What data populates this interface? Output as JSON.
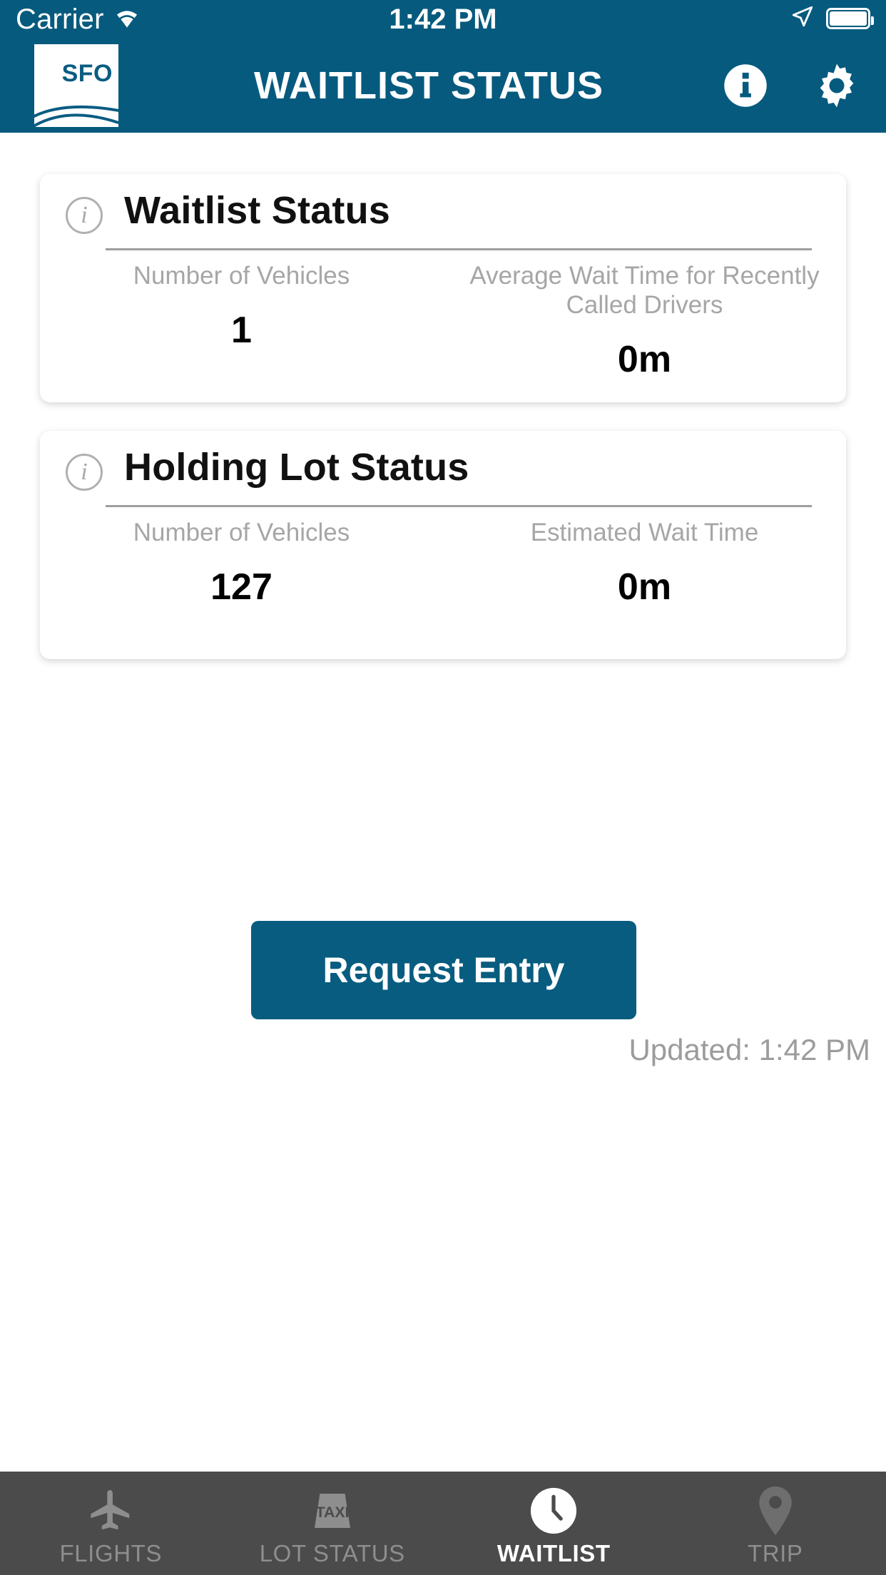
{
  "status_bar": {
    "carrier": "Carrier",
    "time": "1:42 PM",
    "wifi_icon": "wifi-icon",
    "location_icon": "location-arrow-icon",
    "battery_icon": "battery-full-icon"
  },
  "nav": {
    "title": "WAITLIST STATUS",
    "logo_text": "SFO",
    "info_icon": "info-circle-icon",
    "settings_icon": "gear-icon"
  },
  "cards": [
    {
      "id": "waitlist",
      "info_icon": "info-outline-icon",
      "title": "Waitlist Status",
      "stats": [
        {
          "label": "Number of Vehicles",
          "value": "1"
        },
        {
          "label": "Average Wait Time for Recently Called Drivers",
          "value": "0m"
        }
      ]
    },
    {
      "id": "holding-lot",
      "info_icon": "info-outline-icon",
      "title": "Holding Lot Status",
      "stats": [
        {
          "label": "Number of Vehicles",
          "value": "127"
        },
        {
          "label": "Estimated Wait Time",
          "value": "0m"
        }
      ]
    }
  ],
  "action": {
    "request_entry_label": "Request Entry",
    "updated_text": "Updated: 1:42 PM"
  },
  "tabs": [
    {
      "label": "FLIGHTS",
      "icon": "airplane-icon",
      "active": false
    },
    {
      "label": "LOT STATUS",
      "icon": "taxi-sign-icon",
      "active": false
    },
    {
      "label": "WAITLIST",
      "icon": "clock-icon",
      "active": true
    },
    {
      "label": "TRIP",
      "icon": "map-pin-icon",
      "active": false
    }
  ],
  "colors": {
    "brand_teal": "#065A7E",
    "button_teal": "#075C80",
    "tabbar_gray": "#4B4B4B",
    "label_gray": "#A6A6A6"
  }
}
